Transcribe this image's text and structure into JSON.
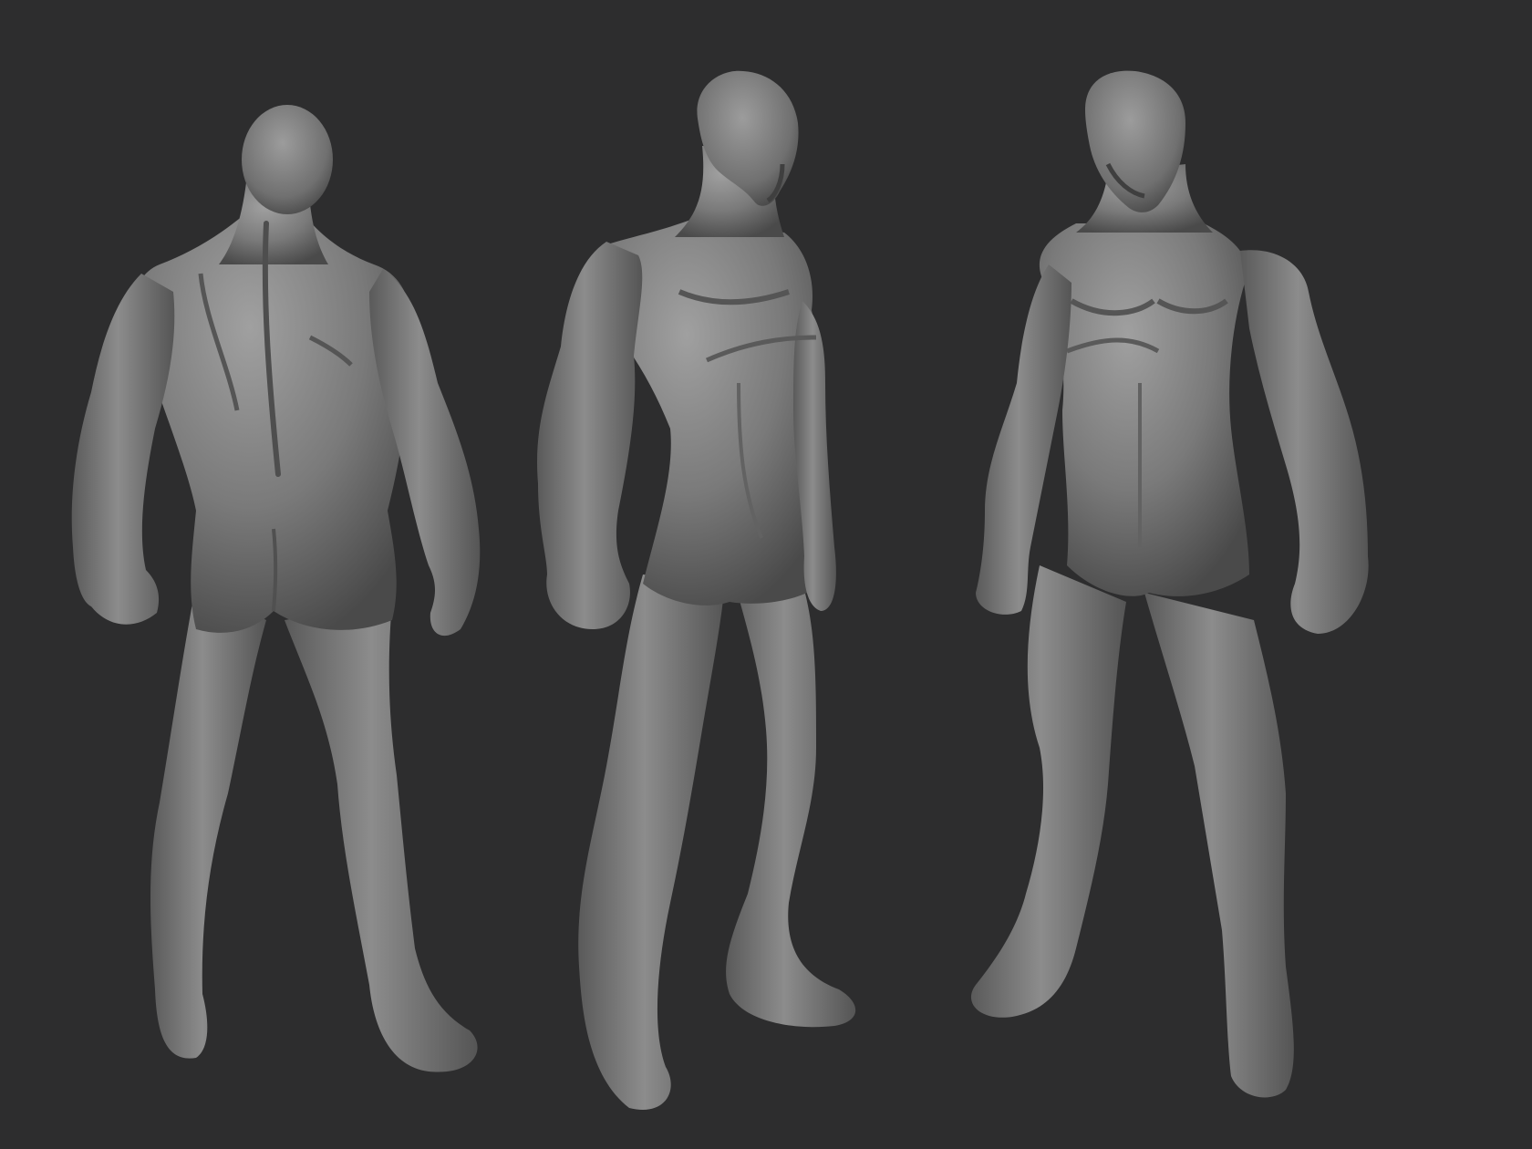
{
  "scene": {
    "background_color": "#2d2d2e",
    "clay_base_color": "#7b7b7b",
    "clay_light_color": "#a3a3a3",
    "clay_shadow_color": "#454545",
    "figures": [
      {
        "view": "back"
      },
      {
        "view": "three-quarter-left"
      },
      {
        "view": "front"
      }
    ]
  }
}
